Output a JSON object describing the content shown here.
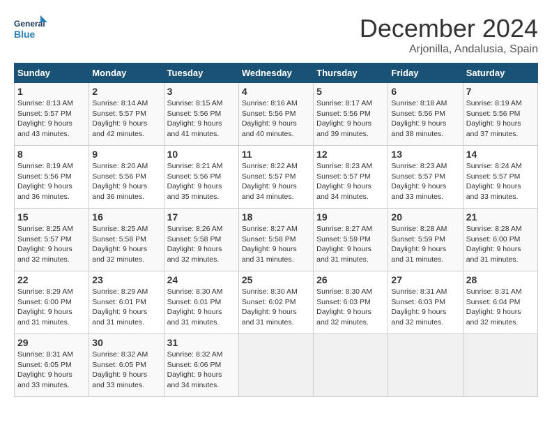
{
  "header": {
    "logo_general": "General",
    "logo_blue": "Blue",
    "month_title": "December 2024",
    "subtitle": "Arjonilla, Andalusia, Spain"
  },
  "calendar": {
    "days_of_week": [
      "Sunday",
      "Monday",
      "Tuesday",
      "Wednesday",
      "Thursday",
      "Friday",
      "Saturday"
    ],
    "weeks": [
      [
        {
          "day": "",
          "empty": true
        },
        {
          "day": "",
          "empty": true
        },
        {
          "day": "",
          "empty": true
        },
        {
          "day": "",
          "empty": true
        },
        {
          "day": "",
          "empty": true
        },
        {
          "day": "",
          "empty": true
        },
        {
          "day": "",
          "empty": true
        }
      ],
      [
        {
          "day": "1",
          "sunrise": "Sunrise: 8:13 AM",
          "sunset": "Sunset: 5:57 PM",
          "daylight": "Daylight: 9 hours and 43 minutes."
        },
        {
          "day": "2",
          "sunrise": "Sunrise: 8:14 AM",
          "sunset": "Sunset: 5:57 PM",
          "daylight": "Daylight: 9 hours and 42 minutes."
        },
        {
          "day": "3",
          "sunrise": "Sunrise: 8:15 AM",
          "sunset": "Sunset: 5:56 PM",
          "daylight": "Daylight: 9 hours and 41 minutes."
        },
        {
          "day": "4",
          "sunrise": "Sunrise: 8:16 AM",
          "sunset": "Sunset: 5:56 PM",
          "daylight": "Daylight: 9 hours and 40 minutes."
        },
        {
          "day": "5",
          "sunrise": "Sunrise: 8:17 AM",
          "sunset": "Sunset: 5:56 PM",
          "daylight": "Daylight: 9 hours and 39 minutes."
        },
        {
          "day": "6",
          "sunrise": "Sunrise: 8:18 AM",
          "sunset": "Sunset: 5:56 PM",
          "daylight": "Daylight: 9 hours and 38 minutes."
        },
        {
          "day": "7",
          "sunrise": "Sunrise: 8:19 AM",
          "sunset": "Sunset: 5:56 PM",
          "daylight": "Daylight: 9 hours and 37 minutes."
        }
      ],
      [
        {
          "day": "8",
          "sunrise": "Sunrise: 8:19 AM",
          "sunset": "Sunset: 5:56 PM",
          "daylight": "Daylight: 9 hours and 36 minutes."
        },
        {
          "day": "9",
          "sunrise": "Sunrise: 8:20 AM",
          "sunset": "Sunset: 5:56 PM",
          "daylight": "Daylight: 9 hours and 36 minutes."
        },
        {
          "day": "10",
          "sunrise": "Sunrise: 8:21 AM",
          "sunset": "Sunset: 5:56 PM",
          "daylight": "Daylight: 9 hours and 35 minutes."
        },
        {
          "day": "11",
          "sunrise": "Sunrise: 8:22 AM",
          "sunset": "Sunset: 5:57 PM",
          "daylight": "Daylight: 9 hours and 34 minutes."
        },
        {
          "day": "12",
          "sunrise": "Sunrise: 8:23 AM",
          "sunset": "Sunset: 5:57 PM",
          "daylight": "Daylight: 9 hours and 34 minutes."
        },
        {
          "day": "13",
          "sunrise": "Sunrise: 8:23 AM",
          "sunset": "Sunset: 5:57 PM",
          "daylight": "Daylight: 9 hours and 33 minutes."
        },
        {
          "day": "14",
          "sunrise": "Sunrise: 8:24 AM",
          "sunset": "Sunset: 5:57 PM",
          "daylight": "Daylight: 9 hours and 33 minutes."
        }
      ],
      [
        {
          "day": "15",
          "sunrise": "Sunrise: 8:25 AM",
          "sunset": "Sunset: 5:57 PM",
          "daylight": "Daylight: 9 hours and 32 minutes."
        },
        {
          "day": "16",
          "sunrise": "Sunrise: 8:25 AM",
          "sunset": "Sunset: 5:58 PM",
          "daylight": "Daylight: 9 hours and 32 minutes."
        },
        {
          "day": "17",
          "sunrise": "Sunrise: 8:26 AM",
          "sunset": "Sunset: 5:58 PM",
          "daylight": "Daylight: 9 hours and 32 minutes."
        },
        {
          "day": "18",
          "sunrise": "Sunrise: 8:27 AM",
          "sunset": "Sunset: 5:58 PM",
          "daylight": "Daylight: 9 hours and 31 minutes."
        },
        {
          "day": "19",
          "sunrise": "Sunrise: 8:27 AM",
          "sunset": "Sunset: 5:59 PM",
          "daylight": "Daylight: 9 hours and 31 minutes."
        },
        {
          "day": "20",
          "sunrise": "Sunrise: 8:28 AM",
          "sunset": "Sunset: 5:59 PM",
          "daylight": "Daylight: 9 hours and 31 minutes."
        },
        {
          "day": "21",
          "sunrise": "Sunrise: 8:28 AM",
          "sunset": "Sunset: 6:00 PM",
          "daylight": "Daylight: 9 hours and 31 minutes."
        }
      ],
      [
        {
          "day": "22",
          "sunrise": "Sunrise: 8:29 AM",
          "sunset": "Sunset: 6:00 PM",
          "daylight": "Daylight: 9 hours and 31 minutes."
        },
        {
          "day": "23",
          "sunrise": "Sunrise: 8:29 AM",
          "sunset": "Sunset: 6:01 PM",
          "daylight": "Daylight: 9 hours and 31 minutes."
        },
        {
          "day": "24",
          "sunrise": "Sunrise: 8:30 AM",
          "sunset": "Sunset: 6:01 PM",
          "daylight": "Daylight: 9 hours and 31 minutes."
        },
        {
          "day": "25",
          "sunrise": "Sunrise: 8:30 AM",
          "sunset": "Sunset: 6:02 PM",
          "daylight": "Daylight: 9 hours and 31 minutes."
        },
        {
          "day": "26",
          "sunrise": "Sunrise: 8:30 AM",
          "sunset": "Sunset: 6:03 PM",
          "daylight": "Daylight: 9 hours and 32 minutes."
        },
        {
          "day": "27",
          "sunrise": "Sunrise: 8:31 AM",
          "sunset": "Sunset: 6:03 PM",
          "daylight": "Daylight: 9 hours and 32 minutes."
        },
        {
          "day": "28",
          "sunrise": "Sunrise: 8:31 AM",
          "sunset": "Sunset: 6:04 PM",
          "daylight": "Daylight: 9 hours and 32 minutes."
        }
      ],
      [
        {
          "day": "29",
          "sunrise": "Sunrise: 8:31 AM",
          "sunset": "Sunset: 6:05 PM",
          "daylight": "Daylight: 9 hours and 33 minutes."
        },
        {
          "day": "30",
          "sunrise": "Sunrise: 8:32 AM",
          "sunset": "Sunset: 6:05 PM",
          "daylight": "Daylight: 9 hours and 33 minutes."
        },
        {
          "day": "31",
          "sunrise": "Sunrise: 8:32 AM",
          "sunset": "Sunset: 6:06 PM",
          "daylight": "Daylight: 9 hours and 34 minutes."
        },
        {
          "day": "",
          "empty": true
        },
        {
          "day": "",
          "empty": true
        },
        {
          "day": "",
          "empty": true
        },
        {
          "day": "",
          "empty": true
        }
      ]
    ]
  }
}
